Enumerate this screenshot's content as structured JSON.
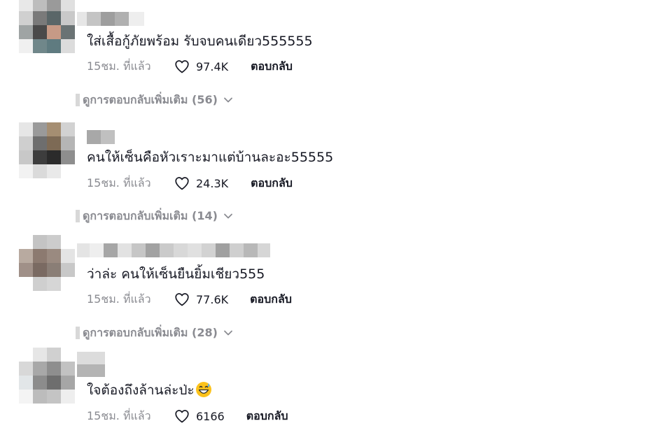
{
  "comments": [
    {
      "text": "ใส่เสื้อกู้ภัยพร้อม รับจบคนเดียว555555",
      "time": "15ชม. ที่แล้ว",
      "likes": "97.4K",
      "reply_label": "ตอบกลับ",
      "replies_label": "ดูการตอบกลับเพิ่มเติม (56)"
    },
    {
      "text": "คนให้เซ็นคือหัวเราะมาแต่บ้านละอะ55555",
      "time": "15ชม. ที่แล้ว",
      "likes": "24.3K",
      "reply_label": "ตอบกลับ",
      "replies_label": "ดูการตอบกลับเพิ่มเติม (14)"
    },
    {
      "text": "ว่าล่ะ คนให้เซ็นยืนยิ้มเชียว555",
      "time": "15ชม. ที่แล้ว",
      "likes": "77.6K",
      "reply_label": "ตอบกลับ",
      "replies_label": "ดูการตอบกลับเพิ่มเติม (28)"
    },
    {
      "text": "ใจต้องถึงล้านล่ะป่ะ",
      "time": "15ชม. ที่แล้ว",
      "likes": "6166",
      "reply_label": "ตอบกลับ",
      "emoji": "grinning-sweat-emoji"
    }
  ],
  "icons": {
    "like": "heart-outline-icon",
    "expand": "chevron-down-icon"
  },
  "colors": {
    "text": "#161823",
    "secondary": "#8a8b91"
  }
}
